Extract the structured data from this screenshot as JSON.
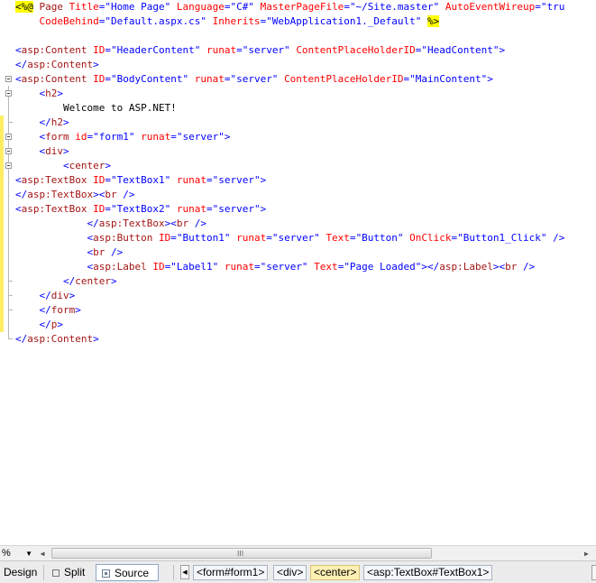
{
  "editor": {
    "lines": [
      [
        {
          "t": "<%@",
          "c": "dir"
        },
        {
          "t": " Page ",
          "c": "tag"
        },
        {
          "t": "Title",
          "c": "attr"
        },
        {
          "t": "=",
          "c": "delim"
        },
        {
          "t": "\"Home Page\"",
          "c": "val"
        },
        {
          "t": " ",
          "c": "text"
        },
        {
          "t": "Language",
          "c": "attr"
        },
        {
          "t": "=",
          "c": "delim"
        },
        {
          "t": "\"C#\"",
          "c": "val"
        },
        {
          "t": " ",
          "c": "text"
        },
        {
          "t": "MasterPageFile",
          "c": "attr"
        },
        {
          "t": "=",
          "c": "delim"
        },
        {
          "t": "\"~/Site.master\"",
          "c": "val"
        },
        {
          "t": " ",
          "c": "text"
        },
        {
          "t": "AutoEventWireup",
          "c": "attr"
        },
        {
          "t": "=",
          "c": "delim"
        },
        {
          "t": "\"tru",
          "c": "val"
        }
      ],
      [
        {
          "t": "    ",
          "c": "text"
        },
        {
          "t": "CodeBehind",
          "c": "attr"
        },
        {
          "t": "=",
          "c": "delim"
        },
        {
          "t": "\"Default.aspx.cs\"",
          "c": "val"
        },
        {
          "t": " ",
          "c": "text"
        },
        {
          "t": "Inherits",
          "c": "attr"
        },
        {
          "t": "=",
          "c": "delim"
        },
        {
          "t": "\"WebApplication1._Default\"",
          "c": "val"
        },
        {
          "t": " ",
          "c": "text"
        },
        {
          "t": "%>",
          "c": "dir"
        }
      ],
      [],
      [
        {
          "t": "<",
          "c": "delim"
        },
        {
          "t": "asp:Content",
          "c": "tag"
        },
        {
          "t": " ",
          "c": "text"
        },
        {
          "t": "ID",
          "c": "attr"
        },
        {
          "t": "=",
          "c": "delim"
        },
        {
          "t": "\"HeaderContent\"",
          "c": "val"
        },
        {
          "t": " ",
          "c": "text"
        },
        {
          "t": "runat",
          "c": "attr"
        },
        {
          "t": "=",
          "c": "delim"
        },
        {
          "t": "\"server\"",
          "c": "val"
        },
        {
          "t": " ",
          "c": "text"
        },
        {
          "t": "ContentPlaceHolderID",
          "c": "attr"
        },
        {
          "t": "=",
          "c": "delim"
        },
        {
          "t": "\"HeadContent\"",
          "c": "val"
        },
        {
          "t": ">",
          "c": "delim"
        }
      ],
      [
        {
          "t": "</",
          "c": "delim"
        },
        {
          "t": "asp:Content",
          "c": "tag"
        },
        {
          "t": ">",
          "c": "delim"
        }
      ],
      [
        {
          "t": "<",
          "c": "delim"
        },
        {
          "t": "asp:Content",
          "c": "tag"
        },
        {
          "t": " ",
          "c": "text"
        },
        {
          "t": "ID",
          "c": "attr"
        },
        {
          "t": "=",
          "c": "delim"
        },
        {
          "t": "\"BodyContent\"",
          "c": "val"
        },
        {
          "t": " ",
          "c": "text"
        },
        {
          "t": "runat",
          "c": "attr"
        },
        {
          "t": "=",
          "c": "delim"
        },
        {
          "t": "\"server\"",
          "c": "val"
        },
        {
          "t": " ",
          "c": "text"
        },
        {
          "t": "ContentPlaceHolderID",
          "c": "attr"
        },
        {
          "t": "=",
          "c": "delim"
        },
        {
          "t": "\"MainContent\"",
          "c": "val"
        },
        {
          "t": ">",
          "c": "delim"
        }
      ],
      [
        {
          "t": "    ",
          "c": "text"
        },
        {
          "t": "<",
          "c": "delim"
        },
        {
          "t": "h2",
          "c": "tag"
        },
        {
          "t": ">",
          "c": "delim"
        }
      ],
      [
        {
          "t": "        Welcome to ASP.NET!",
          "c": "text"
        }
      ],
      [
        {
          "t": "    ",
          "c": "text"
        },
        {
          "t": "</",
          "c": "delim"
        },
        {
          "t": "h2",
          "c": "tag"
        },
        {
          "t": ">",
          "c": "delim"
        }
      ],
      [
        {
          "t": "    ",
          "c": "text"
        },
        {
          "t": "<",
          "c": "delim"
        },
        {
          "t": "form",
          "c": "tag"
        },
        {
          "t": " ",
          "c": "text"
        },
        {
          "t": "id",
          "c": "attr"
        },
        {
          "t": "=",
          "c": "delim"
        },
        {
          "t": "\"form1\"",
          "c": "val"
        },
        {
          "t": " ",
          "c": "text"
        },
        {
          "t": "runat",
          "c": "attr"
        },
        {
          "t": "=",
          "c": "delim"
        },
        {
          "t": "\"server\"",
          "c": "val"
        },
        {
          "t": ">",
          "c": "delim"
        }
      ],
      [
        {
          "t": "    ",
          "c": "text"
        },
        {
          "t": "<",
          "c": "delim"
        },
        {
          "t": "div",
          "c": "tag"
        },
        {
          "t": ">",
          "c": "delim"
        }
      ],
      [
        {
          "t": "        ",
          "c": "text"
        },
        {
          "t": "<",
          "c": "delim"
        },
        {
          "t": "center",
          "c": "tag"
        },
        {
          "t": ">",
          "c": "delim"
        }
      ],
      [
        {
          "t": "<",
          "c": "delim"
        },
        {
          "t": "asp:TextBox",
          "c": "tag"
        },
        {
          "t": " ",
          "c": "text"
        },
        {
          "t": "ID",
          "c": "attr"
        },
        {
          "t": "=",
          "c": "delim"
        },
        {
          "t": "\"TextBox1\"",
          "c": "val"
        },
        {
          "t": " ",
          "c": "text"
        },
        {
          "t": "runat",
          "c": "attr"
        },
        {
          "t": "=",
          "c": "delim"
        },
        {
          "t": "\"server\"",
          "c": "val"
        },
        {
          "t": ">",
          "c": "delim"
        }
      ],
      [
        {
          "t": "</",
          "c": "delim"
        },
        {
          "t": "asp:TextBox",
          "c": "tag"
        },
        {
          "t": ">",
          "c": "delim"
        },
        {
          "t": "<",
          "c": "delim"
        },
        {
          "t": "br",
          "c": "tag"
        },
        {
          "t": " />",
          "c": "delim"
        }
      ],
      [
        {
          "t": "<",
          "c": "delim"
        },
        {
          "t": "asp:TextBox",
          "c": "tag"
        },
        {
          "t": " ",
          "c": "text"
        },
        {
          "t": "ID",
          "c": "attr"
        },
        {
          "t": "=",
          "c": "delim"
        },
        {
          "t": "\"TextBox2\"",
          "c": "val"
        },
        {
          "t": " ",
          "c": "text"
        },
        {
          "t": "runat",
          "c": "attr"
        },
        {
          "t": "=",
          "c": "delim"
        },
        {
          "t": "\"server\"",
          "c": "val"
        },
        {
          "t": ">",
          "c": "delim"
        }
      ],
      [
        {
          "t": "            ",
          "c": "text"
        },
        {
          "t": "</",
          "c": "delim"
        },
        {
          "t": "asp:TextBox",
          "c": "tag"
        },
        {
          "t": ">",
          "c": "delim"
        },
        {
          "t": "<",
          "c": "delim"
        },
        {
          "t": "br",
          "c": "tag"
        },
        {
          "t": " />",
          "c": "delim"
        }
      ],
      [
        {
          "t": "            ",
          "c": "text"
        },
        {
          "t": "<",
          "c": "delim"
        },
        {
          "t": "asp:Button",
          "c": "tag"
        },
        {
          "t": " ",
          "c": "text"
        },
        {
          "t": "ID",
          "c": "attr"
        },
        {
          "t": "=",
          "c": "delim"
        },
        {
          "t": "\"Button1\"",
          "c": "val"
        },
        {
          "t": " ",
          "c": "text"
        },
        {
          "t": "runat",
          "c": "attr"
        },
        {
          "t": "=",
          "c": "delim"
        },
        {
          "t": "\"server\"",
          "c": "val"
        },
        {
          "t": " ",
          "c": "text"
        },
        {
          "t": "Text",
          "c": "attr"
        },
        {
          "t": "=",
          "c": "delim"
        },
        {
          "t": "\"Button\"",
          "c": "val"
        },
        {
          "t": " ",
          "c": "text"
        },
        {
          "t": "OnClick",
          "c": "attr"
        },
        {
          "t": "=",
          "c": "delim"
        },
        {
          "t": "\"Button1_Click\"",
          "c": "val"
        },
        {
          "t": " />",
          "c": "delim"
        }
      ],
      [
        {
          "t": "            ",
          "c": "text"
        },
        {
          "t": "<",
          "c": "delim"
        },
        {
          "t": "br",
          "c": "tag"
        },
        {
          "t": " />",
          "c": "delim"
        }
      ],
      [
        {
          "t": "            ",
          "c": "text"
        },
        {
          "t": "<",
          "c": "delim"
        },
        {
          "t": "asp:Label",
          "c": "tag"
        },
        {
          "t": " ",
          "c": "text"
        },
        {
          "t": "ID",
          "c": "attr"
        },
        {
          "t": "=",
          "c": "delim"
        },
        {
          "t": "\"Label1\"",
          "c": "val"
        },
        {
          "t": " ",
          "c": "text"
        },
        {
          "t": "runat",
          "c": "attr"
        },
        {
          "t": "=",
          "c": "delim"
        },
        {
          "t": "\"server\"",
          "c": "val"
        },
        {
          "t": " ",
          "c": "text"
        },
        {
          "t": "Text",
          "c": "attr"
        },
        {
          "t": "=",
          "c": "delim"
        },
        {
          "t": "\"Page Loaded\"",
          "c": "val"
        },
        {
          "t": ">",
          "c": "delim"
        },
        {
          "t": "</",
          "c": "delim"
        },
        {
          "t": "asp:Label",
          "c": "tag"
        },
        {
          "t": ">",
          "c": "delim"
        },
        {
          "t": "<",
          "c": "delim"
        },
        {
          "t": "br",
          "c": "tag"
        },
        {
          "t": " />",
          "c": "delim"
        }
      ],
      [
        {
          "t": "        ",
          "c": "text"
        },
        {
          "t": "</",
          "c": "delim"
        },
        {
          "t": "center",
          "c": "tag"
        },
        {
          "t": ">",
          "c": "delim"
        }
      ],
      [
        {
          "t": "    ",
          "c": "text"
        },
        {
          "t": "</",
          "c": "delim"
        },
        {
          "t": "div",
          "c": "tag"
        },
        {
          "t": ">",
          "c": "delim"
        }
      ],
      [
        {
          "t": "    ",
          "c": "text"
        },
        {
          "t": "</",
          "c": "delim"
        },
        {
          "t": "form",
          "c": "tag"
        },
        {
          "t": ">",
          "c": "delim"
        }
      ],
      [
        {
          "t": "    ",
          "c": "text"
        },
        {
          "t": "</",
          "c": "delim"
        },
        {
          "t": "p",
          "c": "tag"
        },
        {
          "t": ">",
          "c": "delim"
        }
      ],
      [
        {
          "t": "</",
          "c": "delim"
        },
        {
          "t": "asp:Content",
          "c": "tag"
        },
        {
          "t": ">",
          "c": "delim"
        }
      ]
    ]
  },
  "colors": {
    "tag": "#a31515",
    "attr": "#ff0000",
    "val": "#0000ff",
    "delim": "#0000ff",
    "text": "#000000",
    "directive_highlight": "#ffff00",
    "changed_margin": "#ffee62"
  },
  "icons": {
    "fold": "collapse-minus-icon",
    "split": "split-view-icon",
    "source": "source-view-icon",
    "scroll_left": "arrow-left-icon",
    "scroll_right": "arrow-right-icon",
    "breadcrumb_back": "triangle-left-icon",
    "zoom_dropdown": "chevron-down-icon"
  },
  "zoom": {
    "value": "%"
  },
  "hscroll": {
    "grip": "III"
  },
  "view_tabs": {
    "design": "Design",
    "split": "Split",
    "source": "Source"
  },
  "breadcrumbs": [
    "<form#form1>",
    "<div>",
    "<center>",
    "<asp:TextBox#TextBox1>"
  ]
}
